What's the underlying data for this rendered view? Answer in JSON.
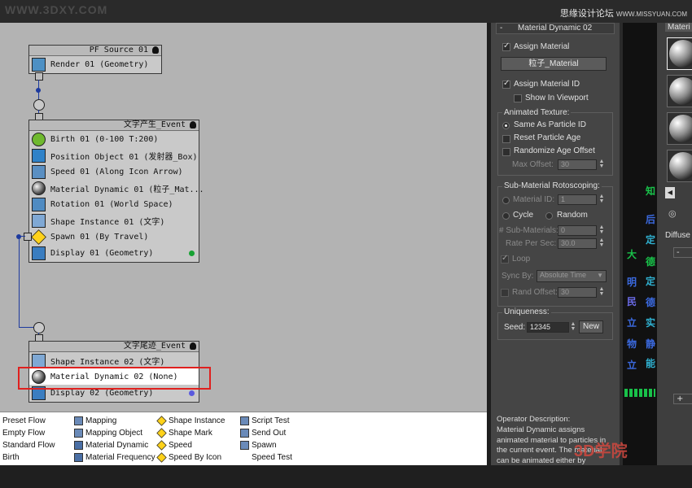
{
  "watermarks": {
    "left": "WWW.3DXY.COM",
    "right_main": "思缘设计论坛",
    "right_url": "WWW.MISSYUAN.COM",
    "bottom": "3D学院"
  },
  "events": [
    {
      "title": "PF Source 01",
      "ops": [
        {
          "icon": "render-icon",
          "label": "Render 01 (Geometry)"
        }
      ]
    },
    {
      "title": "文字产生_Event",
      "ops": [
        {
          "icon": "birth-icon",
          "label": "Birth 01 (0-100 T:200)"
        },
        {
          "icon": "position-object-icon",
          "label": "Position Object 01 (发射器_Box)"
        },
        {
          "icon": "speed-icon",
          "label": "Speed 01 (Along Icon Arrow)"
        },
        {
          "icon": "material-dynamic-icon",
          "label": "Material Dynamic 01 (粒子_Mat..."
        },
        {
          "icon": "rotation-icon",
          "label": "Rotation 01 (World Space)"
        },
        {
          "icon": "shape-instance-icon",
          "label": "Shape Instance 01 (文字)"
        },
        {
          "icon": "spawn-icon",
          "label": "Spawn 01 (By Travel)"
        },
        {
          "icon": "display-icon",
          "label": "Display 01 (Geometry)"
        }
      ]
    },
    {
      "title": "文字尾迹_Event",
      "ops": [
        {
          "icon": "shape-instance-icon",
          "label": "Shape Instance 02 (文字)"
        },
        {
          "icon": "material-dynamic-icon",
          "label": "Material Dynamic 02 (None)"
        },
        {
          "icon": "display-icon",
          "label": "Display 02 (Geometry)"
        }
      ]
    }
  ],
  "depot": {
    "col1": [
      "Preset Flow",
      "Empty Flow",
      "Standard Flow",
      "Birth"
    ],
    "col2": [
      "Mapping",
      "Mapping Object",
      "Material Dynamic",
      "Material Frequency"
    ],
    "col3": [
      "Shape Instance",
      "Shape Mark",
      "Speed",
      "Speed By Icon"
    ],
    "col4": [
      "Script Test",
      "Send Out",
      "Spawn",
      "Speed Test"
    ]
  },
  "rollout": {
    "header": "Material Dynamic 02",
    "collapse_symbol": "-",
    "assign_material": "Assign Material",
    "material_button": "粒子_Material",
    "assign_material_id": "Assign Material ID",
    "show_in_viewport": "Show In Viewport",
    "animated_texture": "Animated Texture:",
    "same_as_particle_id": "Same As Particle ID",
    "reset_particle_age": "Reset Particle Age",
    "randomize_age_offset": "Randomize Age Offset",
    "max_offset_label": "Max Offset:",
    "max_offset_value": "30",
    "sub_material_roto": "Sub-Material Rotoscoping:",
    "material_id_label": "Material ID:",
    "material_id_value": "1",
    "cycle": "Cycle",
    "random": "Random",
    "num_sub_materials_label": "# Sub-Materials:",
    "num_sub_materials_value": "0",
    "rate_per_sec_label": "Rate Per Sec:",
    "rate_per_sec_value": "30.0",
    "loop": "Loop",
    "sync_by_label": "Sync By:",
    "sync_by_value": "Absolute Time",
    "rand_offset_label": "Rand Offset:",
    "rand_offset_value": "30",
    "uniqueness": "Uniqueness:",
    "seed_label": "Seed:",
    "seed_value": "12345",
    "new_button": "New"
  },
  "op_description": {
    "title": "Operator Description:",
    "text": "Material Dynamic assigns animated material to particles in the current event. The material can be animated either by"
  },
  "material_editor": {
    "tab": "Materi",
    "diffuse": "Diffuse",
    "minus": "-",
    "plus": "+"
  },
  "colors": {
    "wire": "#1d3a9e",
    "highlight": "#e0201e",
    "canvas": "#b3b3b3"
  }
}
